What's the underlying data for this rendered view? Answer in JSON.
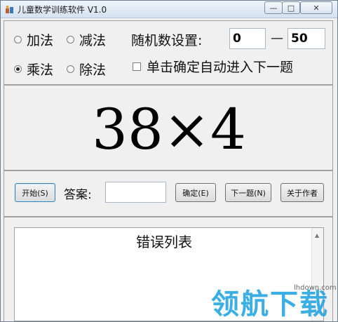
{
  "window": {
    "title": "儿童数学训练软件 V1.0",
    "controls": {
      "minimize": "—",
      "maximize": "□",
      "close": "✕"
    }
  },
  "operations": {
    "add": {
      "label": "加法",
      "selected": false
    },
    "subtract": {
      "label": "减法",
      "selected": false
    },
    "multiply": {
      "label": "乘法",
      "selected": true
    },
    "divide": {
      "label": "除法",
      "selected": false
    }
  },
  "range": {
    "label": "随机数设置:",
    "min": "0",
    "separator": "—",
    "max": "50"
  },
  "auto_next": {
    "label": "单击确定自动进入下一题",
    "checked": false
  },
  "problem": {
    "text": "38×4"
  },
  "answer": {
    "start_label": "开始(S)",
    "answer_label": "答案:",
    "answer_value": "",
    "confirm_label": "确定(E)",
    "next_label": "下一题(N)",
    "about_label": "关于作者"
  },
  "errors": {
    "title": "错误列表"
  },
  "watermark": {
    "text": "领航下载",
    "url": "lhdown.com"
  }
}
